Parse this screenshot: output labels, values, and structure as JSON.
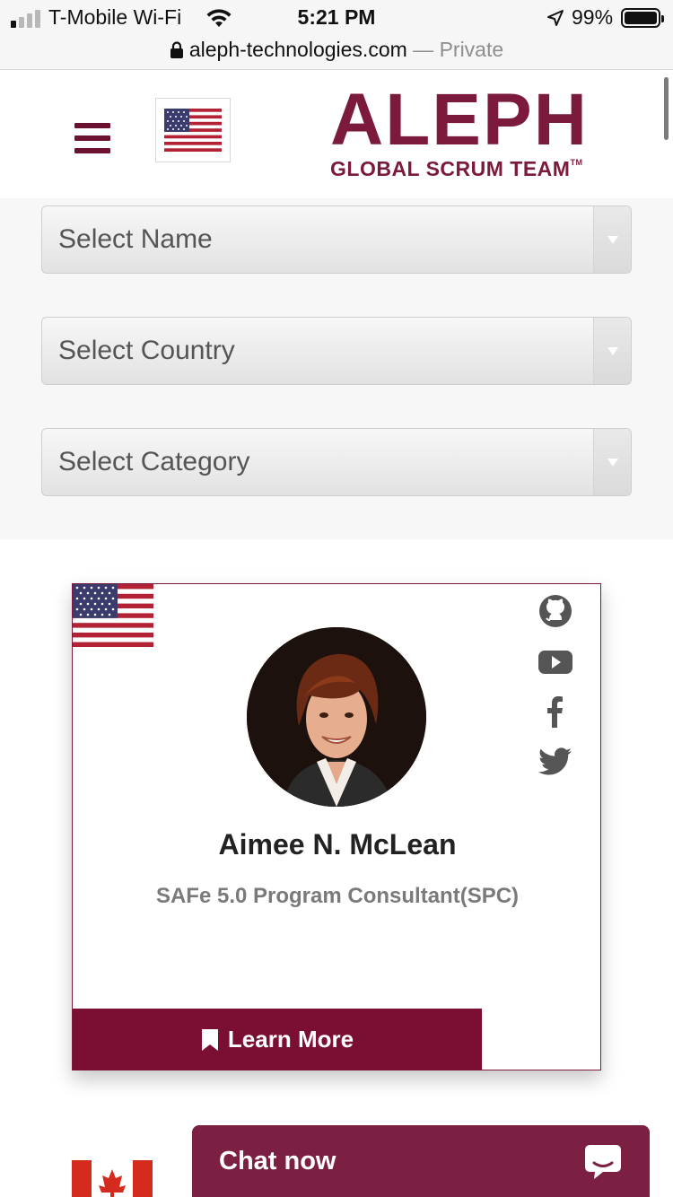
{
  "status_bar": {
    "carrier": "T-Mobile Wi-Fi",
    "time": "5:21 PM",
    "battery": "99%",
    "battery_level": 0.99,
    "signal_bars_active": 1,
    "icons": [
      "signal-icon",
      "wifi-icon",
      "location-arrow-icon",
      "battery-icon"
    ]
  },
  "browser": {
    "url": "aleph-technologies.com",
    "separator": " — ",
    "privacy": "Private"
  },
  "header": {
    "logo_main": "ALEPH",
    "logo_sub": "GLOBAL SCRUM TEAM",
    "logo_mark": "TM",
    "menu_icon": "hamburger-icon",
    "flag": "us-flag-icon"
  },
  "filters": {
    "name": "Select Name",
    "country": "Select Country",
    "category": "Select Category"
  },
  "profile_card": {
    "flag": "us-flag-icon",
    "name": "Aimee N. McLean",
    "title": "SAFe 5.0 Program Consultant(SPC)",
    "learn_more": "Learn More",
    "socials": [
      "github-icon",
      "youtube-icon",
      "facebook-icon",
      "twitter-icon"
    ]
  },
  "next_card": {
    "flag": "canada-flag-icon"
  },
  "chat": {
    "label": "Chat now"
  },
  "colors": {
    "brand": "#7b1a3c",
    "button": "#7a0e33",
    "chat": "#7b2043"
  }
}
